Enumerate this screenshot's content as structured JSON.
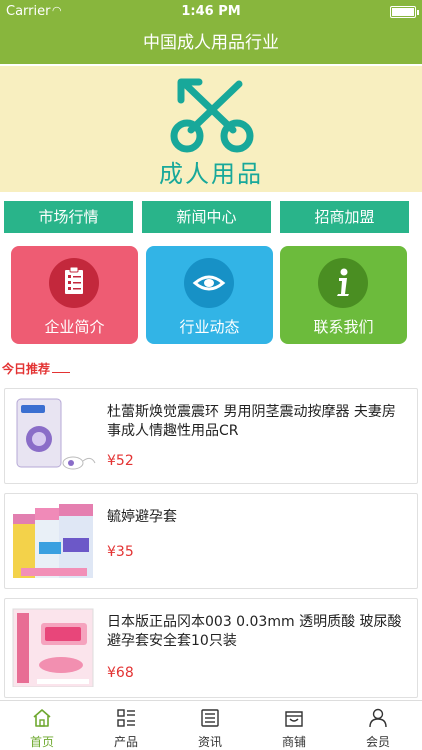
{
  "status_bar": {
    "carrier": "Carrier",
    "time": "1:46 PM"
  },
  "nav": {
    "title": "中国成人用品行业"
  },
  "banner": {
    "text": "成人用品"
  },
  "tabs": [
    {
      "label": "市场行情"
    },
    {
      "label": "新闻中心"
    },
    {
      "label": "招商加盟"
    }
  ],
  "tiles": [
    {
      "label": "企业简介",
      "icon": "document-icon",
      "color": "#ee5c73"
    },
    {
      "label": "行业动态",
      "icon": "eye-icon",
      "color": "#32b4e6"
    },
    {
      "label": "联系我们",
      "icon": "info-icon",
      "color": "#6cbb3c"
    }
  ],
  "section": {
    "title": "今日推荐"
  },
  "products": [
    {
      "name": "杜蕾斯焕觉震震环 男用阴茎震动按摩器 夫妻房事成人情趣性用品CR",
      "price": "¥52"
    },
    {
      "name": "毓婷避孕套",
      "price": "¥35"
    },
    {
      "name": "日本版正品冈本003 0.03mm 透明质酸 玻尿酸 避孕套安全套10只装",
      "price": "¥68"
    }
  ],
  "tab_bar": [
    {
      "label": "首页",
      "icon": "home-icon",
      "active": true
    },
    {
      "label": "产品",
      "icon": "list-icon",
      "active": false
    },
    {
      "label": "资讯",
      "icon": "news-icon",
      "active": false
    },
    {
      "label": "商铺",
      "icon": "store-icon",
      "active": false
    },
    {
      "label": "会员",
      "icon": "user-icon",
      "active": false
    }
  ],
  "colors": {
    "primary": "#88b63d",
    "accent_tab": "#29b48a",
    "price": "#e33333",
    "active_tab": "#6ea82f"
  }
}
